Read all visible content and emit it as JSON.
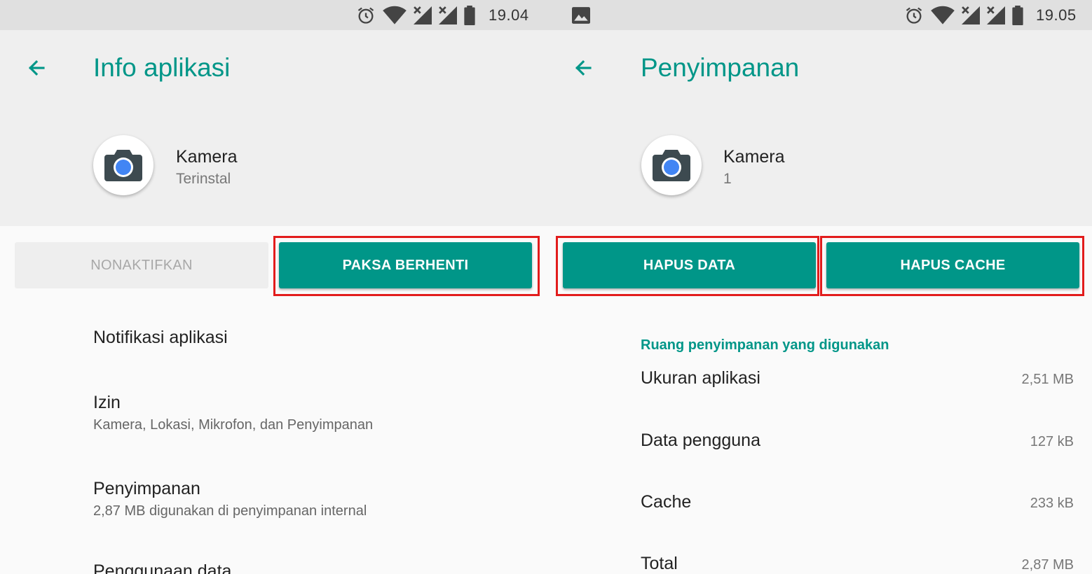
{
  "colors": {
    "accent": "#009688",
    "highlight": "#e21c1c",
    "camera_lens": "#4285f4"
  },
  "left": {
    "status": {
      "time": "19.04",
      "icons": [
        "alarm-icon",
        "wifi-icon",
        "no-signal-icon",
        "no-signal-icon",
        "battery-icon"
      ]
    },
    "header": {
      "title": "Info aplikasi",
      "back_icon": "arrow-left-icon"
    },
    "app": {
      "name": "Kamera",
      "subtitle": "Terinstal",
      "icon": "camera-icon"
    },
    "buttons": {
      "disable": "NONAKTIFKAN",
      "force_stop": "PAKSA BERHENTI"
    },
    "items": [
      {
        "title": "Notifikasi aplikasi",
        "subtitle": ""
      },
      {
        "title": "Izin",
        "subtitle": "Kamera, Lokasi, Mikrofon, dan Penyimpanan"
      },
      {
        "title": "Penyimpanan",
        "subtitle": "2,87 MB digunakan di penyimpanan internal"
      },
      {
        "title": "Penggunaan data",
        "subtitle": ""
      }
    ]
  },
  "right": {
    "status": {
      "time": "19.05",
      "icons": [
        "image-icon",
        "alarm-icon",
        "wifi-icon",
        "no-signal-icon",
        "no-signal-icon",
        "battery-icon"
      ]
    },
    "header": {
      "title": "Penyimpanan",
      "back_icon": "arrow-left-icon"
    },
    "app": {
      "name": "Kamera",
      "subtitle": "1",
      "icon": "camera-icon"
    },
    "buttons": {
      "clear_data": "HAPUS DATA",
      "clear_cache": "HAPUS CACHE"
    },
    "section_title": "Ruang penyimpanan yang digunakan",
    "rows": [
      {
        "label": "Ukuran aplikasi",
        "value": "2,51 MB"
      },
      {
        "label": "Data pengguna",
        "value": "127 kB"
      },
      {
        "label": "Cache",
        "value": "233 kB"
      },
      {
        "label": "Total",
        "value": "2,87 MB"
      }
    ]
  }
}
